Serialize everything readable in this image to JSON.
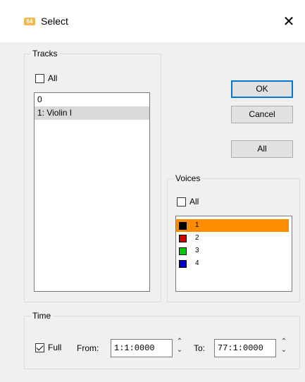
{
  "window": {
    "title": "Select",
    "app_icon_text": "64",
    "close_glyph": "✕"
  },
  "tracks": {
    "group_label": "Tracks",
    "all_label": "All",
    "all_checked": false,
    "items": [
      {
        "label": "0",
        "selected": false
      },
      {
        "label": "1: Violin I",
        "selected": true
      }
    ]
  },
  "buttons": {
    "ok": "OK",
    "cancel": "Cancel",
    "all": "All"
  },
  "voices": {
    "group_label": "Voices",
    "all_label": "All",
    "all_checked": false,
    "items": [
      {
        "label": "1",
        "color": "#000000",
        "selected": true
      },
      {
        "label": "2",
        "color": "#cc0000",
        "selected": false
      },
      {
        "label": "3",
        "color": "#00cc00",
        "selected": false
      },
      {
        "label": "4",
        "color": "#0000cc",
        "selected": false
      }
    ],
    "selection_color": "#ff8c00"
  },
  "time": {
    "group_label": "Time",
    "full_label": "Full",
    "full_checked": true,
    "from_label": "From:",
    "from_value": "1:1:0000",
    "to_label": "To:",
    "to_value": "77:1:0000"
  },
  "icons": {
    "spin_up": "⌃",
    "spin_down": "⌄"
  }
}
